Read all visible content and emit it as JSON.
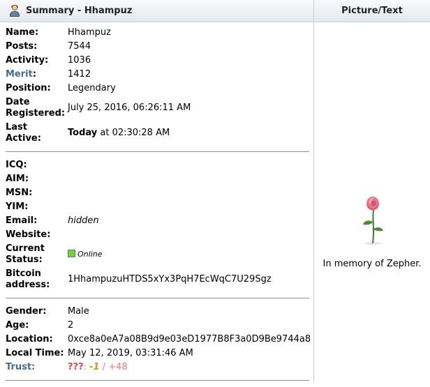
{
  "header": {
    "summary_title": "Summary - Hhampuz",
    "picture_title": "Picture/Text"
  },
  "profile": {
    "name_label": "Name:",
    "name": "Hhampuz",
    "posts_label": "Posts:",
    "posts": "7544",
    "activity_label": "Activity:",
    "activity": "1036",
    "merit_label": "Merit",
    "merit_colon": ":",
    "merit": "1412",
    "position_label": "Position:",
    "position": "Legendary",
    "registered_label_1": "Date",
    "registered_label_2": "Registered:",
    "registered": "July 25, 2016, 06:26:11 AM",
    "active_label_1": "Last",
    "active_label_2": "Active:",
    "active_today": "Today",
    "active_time": " at 02:30:28 AM"
  },
  "contact": {
    "icq_label": "ICQ:",
    "aim_label": "AIM:",
    "msn_label": "MSN:",
    "yim_label": "YIM:",
    "email_label": "Email:",
    "email": "hidden",
    "website_label": "Website:",
    "status_label_1": "Current",
    "status_label_2": "Status:",
    "status": "Online",
    "bitcoin_label_1": "Bitcoin",
    "bitcoin_label_2": "address:",
    "bitcoin": "1HhampuzuHTDS5xYx3PqH7EcWqC7U29Sgz"
  },
  "details": {
    "gender_label": "Gender:",
    "gender": "Male",
    "age_label": "Age:",
    "age": "2",
    "location_label": "Location:",
    "location": "0xce8a0eA7a08B9d9e03eD1977B8F3a0D9Be9744a8",
    "localtime_label": "Local Time:",
    "localtime": "May 12, 2019, 03:31:46 AM",
    "trust_label": "Trust:",
    "trust_q": "???",
    "trust_sep1": ": ",
    "trust_neg": "-1",
    "trust_sep2": " / ",
    "trust_pos": "+48"
  },
  "picture": {
    "caption": "In memory of Zepher."
  },
  "colors": {
    "merit_label": "#476c8e",
    "trust_unknown": "#e34a4a",
    "trust_negative": "#e78b1e",
    "trust_positive": "#ef7a7a",
    "online": "#7ed321"
  },
  "icons": {
    "header": "user-icon",
    "status": "online-status-icon",
    "picture": "rose-image"
  }
}
